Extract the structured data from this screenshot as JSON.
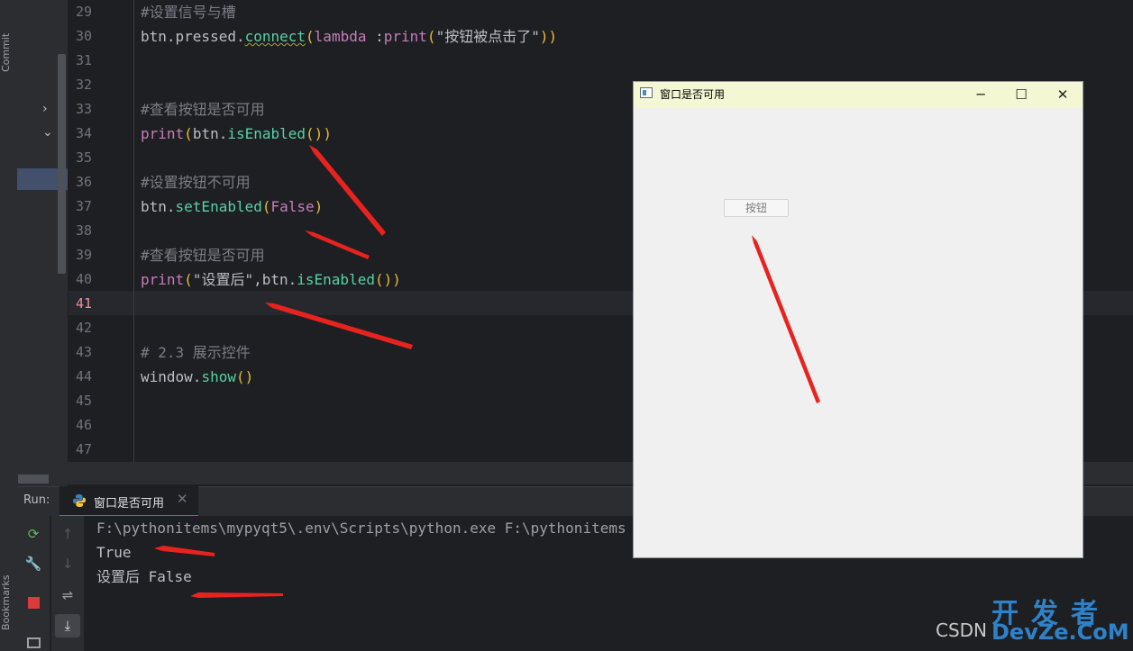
{
  "left_strip": {
    "commit_label": "Commit",
    "bookmarks_label": "Bookmarks"
  },
  "editor": {
    "current_line": "41",
    "lines": [
      {
        "num": "29",
        "segments": [
          {
            "t": "#设置信号与槽",
            "c": "c-comment"
          }
        ]
      },
      {
        "num": "30",
        "segments": [
          {
            "t": "btn.pressed.",
            "c": ""
          },
          {
            "t": "connect",
            "c": "c-call c-under"
          },
          {
            "t": "(",
            "c": "c-par"
          },
          {
            "t": "lambda ",
            "c": "c-purple"
          },
          {
            "t": ":",
            "c": ""
          },
          {
            "t": "print",
            "c": "c-purple"
          },
          {
            "t": "(",
            "c": "c-par"
          },
          {
            "t": "\"按钮被点击了\"",
            "c": ""
          },
          {
            "t": "))",
            "c": "c-par"
          }
        ]
      },
      {
        "num": "31",
        "segments": []
      },
      {
        "num": "32",
        "segments": []
      },
      {
        "num": "33",
        "segments": [
          {
            "t": "#查看按钮是否可用",
            "c": "c-comment"
          }
        ]
      },
      {
        "num": "34",
        "segments": [
          {
            "t": "print",
            "c": "c-purple"
          },
          {
            "t": "(",
            "c": "c-par"
          },
          {
            "t": "btn.",
            "c": ""
          },
          {
            "t": "isEnabled",
            "c": "c-call"
          },
          {
            "t": "())",
            "c": "c-par"
          }
        ]
      },
      {
        "num": "35",
        "segments": []
      },
      {
        "num": "36",
        "segments": [
          {
            "t": "#设置按钮不可用",
            "c": "c-comment"
          }
        ]
      },
      {
        "num": "37",
        "segments": [
          {
            "t": "btn.",
            "c": ""
          },
          {
            "t": "setEnabled",
            "c": "c-call"
          },
          {
            "t": "(",
            "c": "c-par"
          },
          {
            "t": "False",
            "c": "c-purple"
          },
          {
            "t": ")",
            "c": "c-par"
          }
        ]
      },
      {
        "num": "38",
        "segments": []
      },
      {
        "num": "39",
        "segments": [
          {
            "t": "#查看按钮是否可用",
            "c": "c-comment"
          }
        ]
      },
      {
        "num": "40",
        "segments": [
          {
            "t": "print",
            "c": "c-purple"
          },
          {
            "t": "(",
            "c": "c-par"
          },
          {
            "t": "\"设置后\"",
            "c": ""
          },
          {
            "t": ",btn.",
            "c": ""
          },
          {
            "t": "isEnabled",
            "c": "c-call"
          },
          {
            "t": "())",
            "c": "c-par"
          }
        ]
      },
      {
        "num": "41",
        "segments": []
      },
      {
        "num": "42",
        "segments": []
      },
      {
        "num": "43",
        "segments": [
          {
            "t": "# 2.3 展示控件",
            "c": "c-comment"
          }
        ]
      },
      {
        "num": "44",
        "segments": [
          {
            "t": "window.",
            "c": ""
          },
          {
            "t": "show",
            "c": "c-call"
          },
          {
            "t": "()",
            "c": "c-par"
          }
        ]
      },
      {
        "num": "45",
        "segments": []
      },
      {
        "num": "46",
        "segments": []
      },
      {
        "num": "47",
        "segments": []
      }
    ]
  },
  "run_panel": {
    "label": "Run:",
    "tab_label": "窗口是否可用",
    "tab_close": "✕",
    "console_lines": [
      "F:\\pythonitems\\mypyqt5\\.env\\Scripts\\python.exe F:\\pythonitems",
      "True",
      "设置后 False"
    ]
  },
  "qt_window": {
    "title": "窗口是否可用",
    "minimize": "─",
    "maximize": "☐",
    "close": "✕",
    "button_label": "按钮",
    "button_enabled": false
  },
  "watermark": {
    "top": "开发者",
    "bottom": "DevZe.CoM",
    "csdn": "CSDN"
  },
  "colors": {
    "arrow": "#e8231f",
    "accent": "#3574f0"
  }
}
